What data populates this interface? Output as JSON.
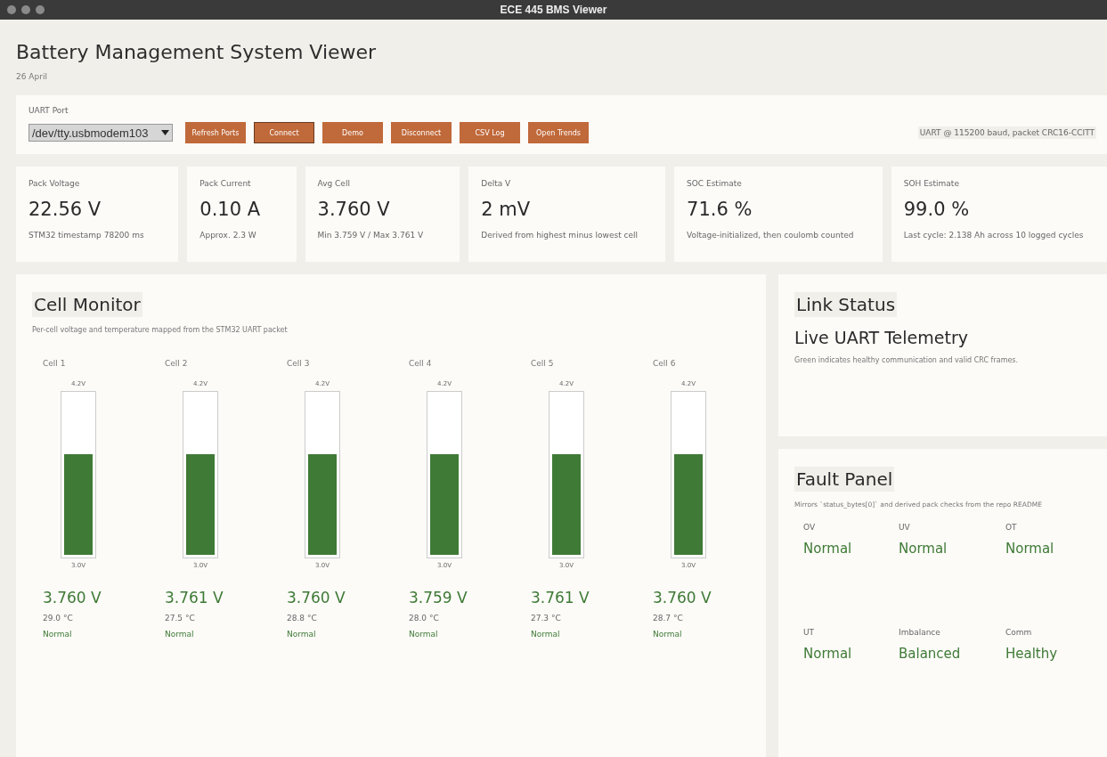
{
  "window": {
    "title": "ECE 445 BMS Viewer"
  },
  "header": {
    "title": "Battery Management System Viewer",
    "date": "26 April"
  },
  "toolbar": {
    "port_label": "UART Port",
    "port_value": "/dev/tty.usbmodem103",
    "buttons": [
      {
        "label": "Refresh Ports",
        "selected": false
      },
      {
        "label": "Connect",
        "selected": true
      },
      {
        "label": "Demo",
        "selected": false
      },
      {
        "label": "Disconnect",
        "selected": false
      },
      {
        "label": "CSV Log",
        "selected": false
      },
      {
        "label": "Open Trends",
        "selected": false
      }
    ],
    "link_info": "UART @ 115200 baud, packet CRC16-CCITT"
  },
  "metrics": [
    {
      "label": "Pack Voltage",
      "value": "22.56 V",
      "note": "STM32 timestamp 78200 ms"
    },
    {
      "label": "Pack Current",
      "value": "0.10 A",
      "note": "Approx. 2.3 W"
    },
    {
      "label": "Avg Cell",
      "value": "3.760 V",
      "note": "Min 3.759 V / Max 3.761 V"
    },
    {
      "label": "Delta V",
      "value": "2 mV",
      "note": "Derived from highest minus lowest cell"
    },
    {
      "label": "SOC Estimate",
      "value": "71.6 %",
      "note": "Voltage-initialized, then coulomb counted"
    },
    {
      "label": "SOH Estimate",
      "value": "99.0 %",
      "note": "Last cycle: 2.138 Ah across 10 logged cycles"
    }
  ],
  "cell_monitor": {
    "title": "Cell Monitor",
    "subtitle": "Per-cell voltage and temperature mapped from the STM32 UART packet",
    "cells": [
      {
        "name": "Cell 1",
        "max": "4.2V",
        "min": "3.0V",
        "level": 0.63,
        "voltage": "3.760 V",
        "temperature": "29.0 °C",
        "status": "Normal",
        "color": "#3f7a36"
      },
      {
        "name": "Cell 2",
        "max": "4.2V",
        "min": "3.0V",
        "level": 0.63,
        "voltage": "3.761 V",
        "temperature": "27.5 °C",
        "status": "Normal",
        "color": "#3f7a36"
      },
      {
        "name": "Cell 3",
        "max": "4.2V",
        "min": "3.0V",
        "level": 0.63,
        "voltage": "3.760 V",
        "temperature": "28.8 °C",
        "status": "Normal",
        "color": "#3f7a36"
      },
      {
        "name": "Cell 4",
        "max": "4.2V",
        "min": "3.0V",
        "level": 0.63,
        "voltage": "3.759 V",
        "temperature": "28.0 °C",
        "status": "Normal",
        "color": "#3f7a36"
      },
      {
        "name": "Cell 5",
        "max": "4.2V",
        "min": "3.0V",
        "level": 0.63,
        "voltage": "3.761 V",
        "temperature": "27.3 °C",
        "status": "Normal",
        "color": "#3f7a36"
      },
      {
        "name": "Cell 6",
        "max": "4.2V",
        "min": "3.0V",
        "level": 0.63,
        "voltage": "3.760 V",
        "temperature": "28.7 °C",
        "status": "Normal",
        "color": "#3f7a36"
      }
    ]
  },
  "link_status": {
    "title": "Link Status",
    "state": "Live UART Telemetry",
    "note": "Green indicates healthy communication and valid CRC frames."
  },
  "fault_panel": {
    "title": "Fault Panel",
    "subtitle": "Mirrors `status_bytes[0]` and derived pack checks from the repo README",
    "faults": [
      {
        "label": "OV",
        "value": "Normal",
        "color": "#3f7a36"
      },
      {
        "label": "UV",
        "value": "Normal",
        "color": "#3f7a36"
      },
      {
        "label": "OT",
        "value": "Normal",
        "color": "#3f7a36"
      },
      {
        "label": "UT",
        "value": "Normal",
        "color": "#3f7a36"
      },
      {
        "label": "Imbalance",
        "value": "Balanced",
        "color": "#3f7a36"
      },
      {
        "label": "Comm",
        "value": "Healthy",
        "color": "#3f7a36"
      }
    ]
  }
}
